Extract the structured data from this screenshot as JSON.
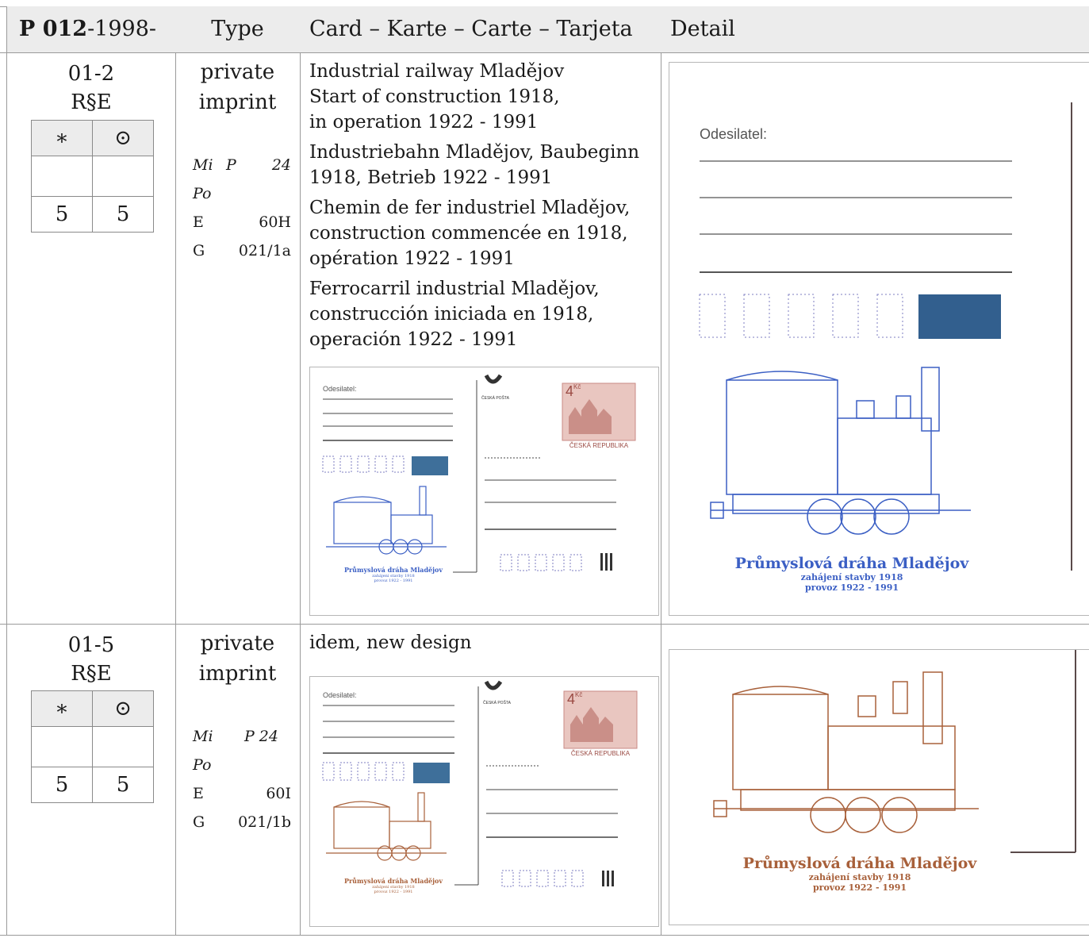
{
  "header": {
    "catalog_bold": "P 012",
    "catalog_rest": "-1998-",
    "type": "Type",
    "card": "Card – Karte – Carte – Tarjeta",
    "detail": "Detail"
  },
  "rows": [
    {
      "number": "01-2",
      "rse": "R§E",
      "mint_symbol": "∗",
      "used_symbol": "⊙",
      "mint_value": "5",
      "used_value": "5",
      "type_line1": "private",
      "type_line2": "imprint",
      "mi_label": "Mi",
      "mi_value_a": "P",
      "mi_value_b": "24",
      "po_label": "Po",
      "e_label": "E",
      "e_value": "60H",
      "g_label": "G",
      "g_value": "021/1a",
      "desc_en": [
        "Industrial railway Mladějov",
        "Start of construction 1918,",
        "in operation 1922 - 1991"
      ],
      "desc_de": [
        "Industriebahn Mladějov, Baubeginn",
        "1918, Betrieb 1922 - 1991"
      ],
      "desc_fr": [
        "Chemin de fer industriel Mladějov,",
        "construction commencée en 1918,",
        "opération 1922 - 1991"
      ],
      "desc_es": [
        "Ferrocarril industrial Mladějov,",
        "construcción iniciada en 1918,",
        "operación 1922 - 1991"
      ],
      "card": {
        "sender_label": "Odesilatel:",
        "post_label": "ČESKÁ POŠTA",
        "stamp_value": "4",
        "stamp_currency": "Kč",
        "stamp_country": "ČESKÁ REPUBLIKA",
        "caption_title": "Průmyslová dráha Mladějov",
        "caption_line2": "zahájení stavby 1918",
        "caption_line3": "provoz 1922 - 1991",
        "ink": "#3b5fc4"
      },
      "detail": {
        "sender_label": "Odesilatel:",
        "caption_title": "Průmyslová dráha Mladějov",
        "caption_line2": "zahájení stavby 1918",
        "caption_line3": "provoz 1922 - 1991",
        "ink": "#3b5fc4"
      }
    },
    {
      "number": "01-5",
      "rse": "R§E",
      "mint_symbol": "∗",
      "used_symbol": "⊙",
      "mint_value": "5",
      "used_value": "5",
      "type_line1": "private",
      "type_line2": "imprint",
      "mi_label": "Mi",
      "mi_value": "P 24",
      "po_label": "Po",
      "e_label": "E",
      "e_value": "60I",
      "g_label": "G",
      "g_value": "021/1b",
      "desc": "idem, new design",
      "card": {
        "sender_label": "Odesilatel:",
        "post_label": "ČESKÁ POŠTA",
        "stamp_value": "4",
        "stamp_currency": "Kč",
        "stamp_country": "ČESKÁ REPUBLIKA",
        "caption_title": "Průmyslová dráha Mladějov",
        "caption_line2": "zahájení stavby 1918",
        "caption_line3": "provoz 1922 - 1991",
        "ink": "#a8603a"
      },
      "detail": {
        "caption_title": "Průmyslová dráha Mladějov",
        "caption_line2": "zahájení stavby 1918",
        "caption_line3": "provoz 1922 - 1991",
        "ink": "#a8603a"
      }
    }
  ]
}
